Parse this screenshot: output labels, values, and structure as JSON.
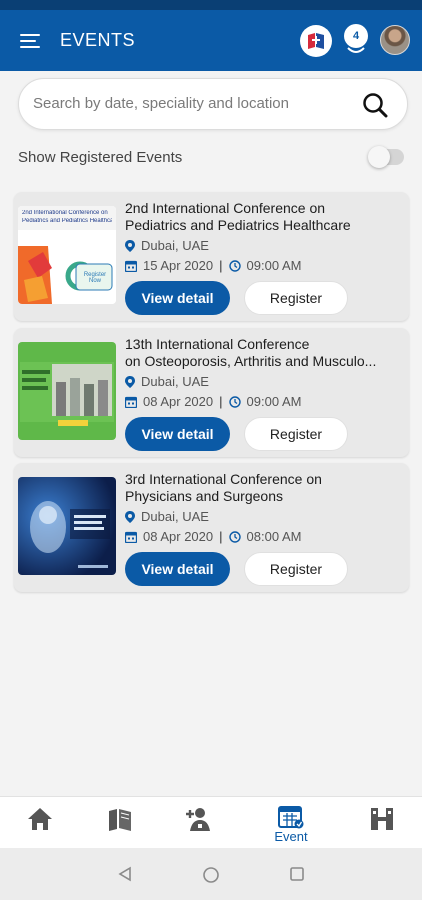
{
  "header": {
    "title": "EVENTS",
    "notification_count": "4",
    "accent": "#0b5aa6"
  },
  "search": {
    "placeholder": "Search by date, speciality and location"
  },
  "filter": {
    "show_registered_label": "Show Registered Events",
    "show_registered_on": false
  },
  "events": [
    {
      "title_line1": "2nd International Conference on",
      "title_line2": "Pediatrics and Pediatrics Healthcare",
      "location": "Dubai, UAE",
      "date": "15 Apr 2020",
      "time": "09:00 AM",
      "view_label": "View detail",
      "register_label": "Register",
      "thumb": {
        "line1": "2nd International Conference on",
        "line2": "Pediatrics and Pediatrics Healthcare",
        "cta": "Register Now"
      }
    },
    {
      "title_line1": "13th International Conference",
      "title_line2": "on Osteoporosis, Arthritis and Musculo...",
      "location": "Dubai, UAE",
      "date": "08 Apr 2020",
      "time": "09:00 AM",
      "view_label": "View detail",
      "register_label": "Register"
    },
    {
      "title_line1": "3rd International Conference on",
      "title_line2": "Physicians and Surgeons",
      "location": "Dubai, UAE",
      "date": "08 Apr 2020",
      "time": "08:00 AM",
      "view_label": "View detail",
      "register_label": "Register"
    }
  ],
  "bottom_nav": [
    {
      "icon": "home-icon",
      "label": ""
    },
    {
      "icon": "books-icon",
      "label": ""
    },
    {
      "icon": "doctor-add-icon",
      "label": ""
    },
    {
      "icon": "calendar-event-icon",
      "label": "Event",
      "active": true
    },
    {
      "icon": "network-icon",
      "label": ""
    }
  ]
}
